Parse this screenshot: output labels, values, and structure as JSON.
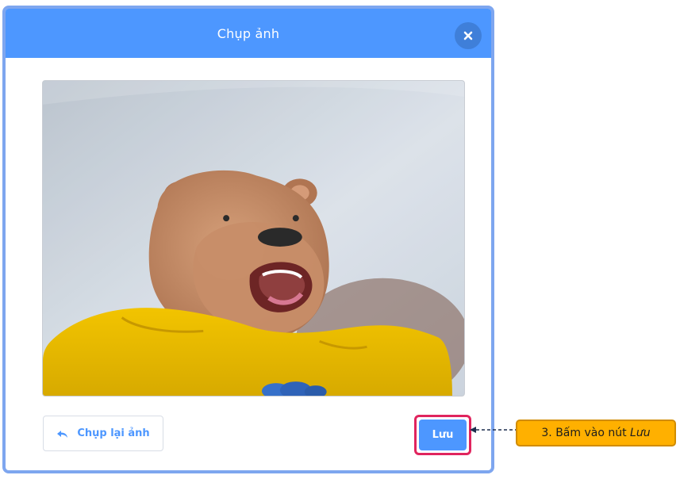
{
  "dialog": {
    "title": "Chụp ảnh",
    "close_icon": "close-icon"
  },
  "actions": {
    "retake_label": "Chụp lại ảnh",
    "retake_icon": "undo-icon",
    "save_label": "Lưu"
  },
  "annotation": {
    "prefix": "3. Bấm vào nút",
    "emphasis": "Lưu"
  },
  "colors": {
    "header": "#4d97ff",
    "frame": "#7ea6ef",
    "save_highlight": "#e0245e",
    "callout": "#ffb000"
  }
}
